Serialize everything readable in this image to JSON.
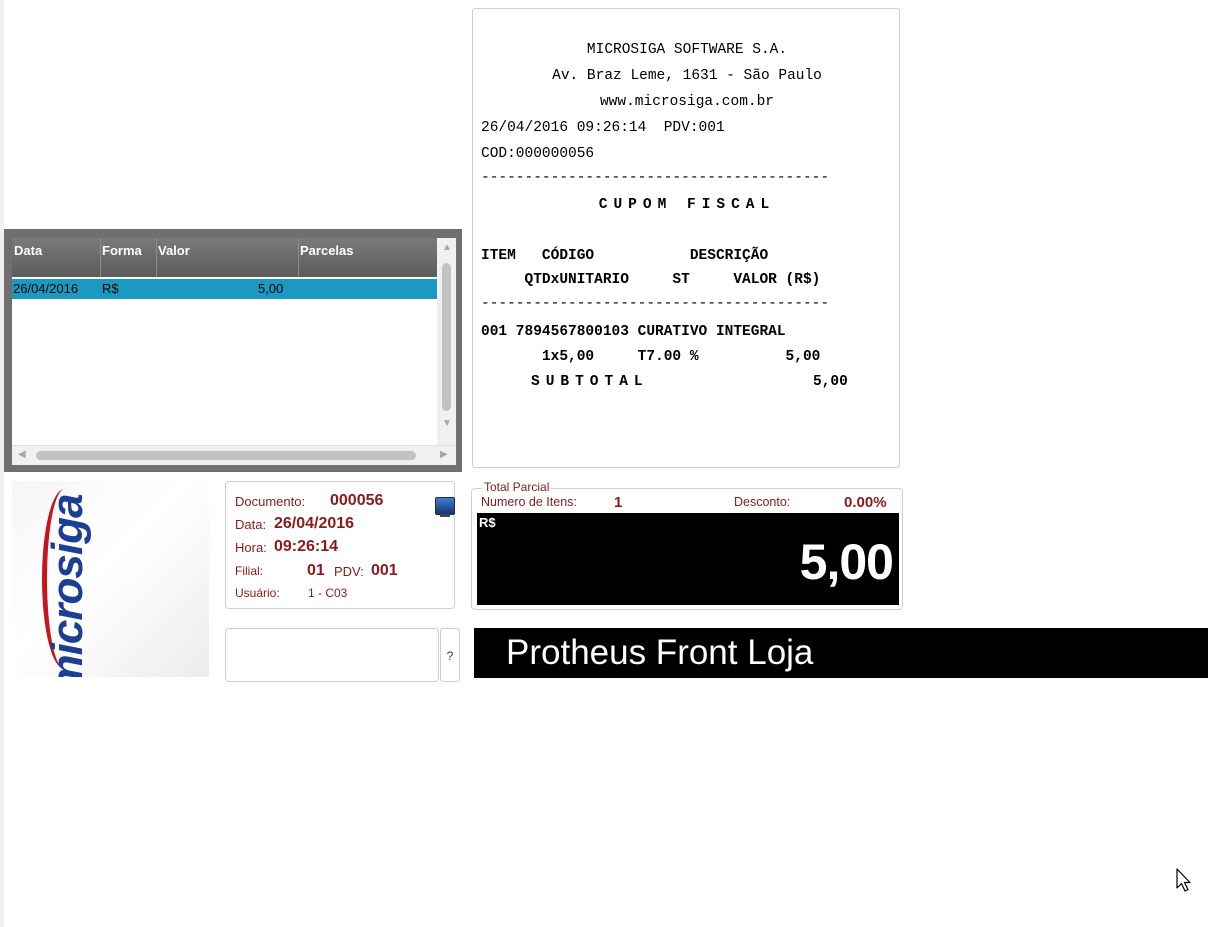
{
  "receipt": {
    "company": "MICROSIGA SOFTWARE S.A.",
    "address": "Av. Braz Leme, 1631 - São Paulo",
    "website": "www.microsiga.com.br",
    "datetime_pdv": "26/04/2016 09:26:14  PDV:001",
    "cod": "COD:000000056",
    "separator": "----------------------------------------",
    "title": "CUPOM FISCAL",
    "header_line1": "ITEM   CÓDIGO           DESCRIÇÃO",
    "header_line2": "     QTDxUNITARIO     ST     VALOR (R$)",
    "separator2": "----------------------------------------",
    "item_line1": "001 7894567800103 CURATIVO INTEGRAL",
    "item_line2": "       1x5,00     T7.00 %          5,00",
    "subtotal_label": "SUBTOTAL",
    "subtotal_value": "5,00"
  },
  "payments_grid": {
    "columns": [
      "Data",
      "Forma",
      "Valor",
      "Parcelas"
    ],
    "rows": [
      {
        "data": "26/04/2016",
        "forma": "R$",
        "valor": "5,00",
        "parcelas": ""
      }
    ]
  },
  "logo": {
    "text": "microsiga"
  },
  "document": {
    "documento_label": "Documento:",
    "documento_value": "000056",
    "data_label": "Data:",
    "data_value": "26/04/2016",
    "hora_label": "Hora:",
    "hora_value": "09:26:14",
    "filial_label": "Filial:",
    "filial_value": "01",
    "pdv_label": "PDV:",
    "pdv_value": "001",
    "usuario_label": "Usuário:",
    "usuario_value": "1 - C03"
  },
  "total_parcial": {
    "title": "Total Parcial",
    "num_itens_label": "Numero de Itens:",
    "num_itens_value": "1",
    "desconto_label": "Desconto:",
    "desconto_value": "0.00%",
    "currency": "R$",
    "amount": "5,00"
  },
  "command": {
    "value": "",
    "help_label": "?"
  },
  "banner": {
    "text": "Protheus Front Loja"
  },
  "colors": {
    "accent_dark_red": "#8b1a1a",
    "grid_selection": "#1a9ac0",
    "banner_bg": "#000000"
  }
}
